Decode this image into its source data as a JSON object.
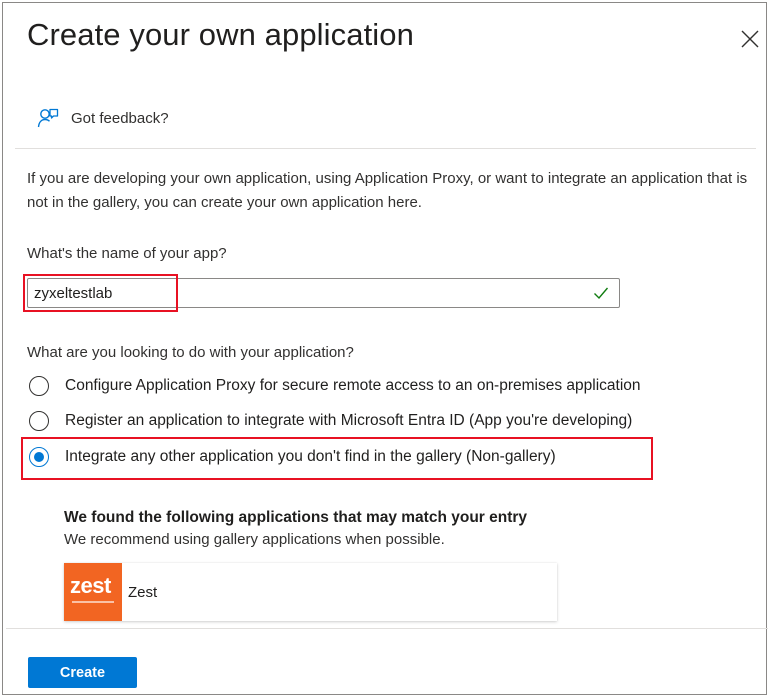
{
  "dialog": {
    "title": "Create your own application",
    "close_icon": "close-icon",
    "feedback_label": "Got feedback?",
    "feedback_icon": "feedback-person-icon",
    "description": "If you are developing your own application, using Application Proxy, or want to integrate an application that is not in the gallery, you can create your own application here."
  },
  "app_name": {
    "label": "What's the name of your app?",
    "value": "zyxeltestlab",
    "valid_icon": "checkmark-icon",
    "valid_color": "#107c10"
  },
  "purpose": {
    "label": "What are you looking to do with your application?",
    "options": [
      {
        "label": "Configure Application Proxy for secure remote access to an on-premises application",
        "selected": false
      },
      {
        "label": "Register an application to integrate with Microsoft Entra ID (App you're developing)",
        "selected": false
      },
      {
        "label": "Integrate any other application you don't find in the gallery (Non-gallery)",
        "selected": true
      }
    ]
  },
  "matches": {
    "title": "We found the following applications that may match your entry",
    "subtitle": "We recommend using gallery applications when possible.",
    "items": [
      {
        "logo_text": "zest",
        "name": "Zest",
        "logo_color": "#f26522"
      }
    ]
  },
  "footer": {
    "create_label": "Create"
  },
  "colors": {
    "accent": "#0078d4",
    "highlight": "#e81123"
  }
}
